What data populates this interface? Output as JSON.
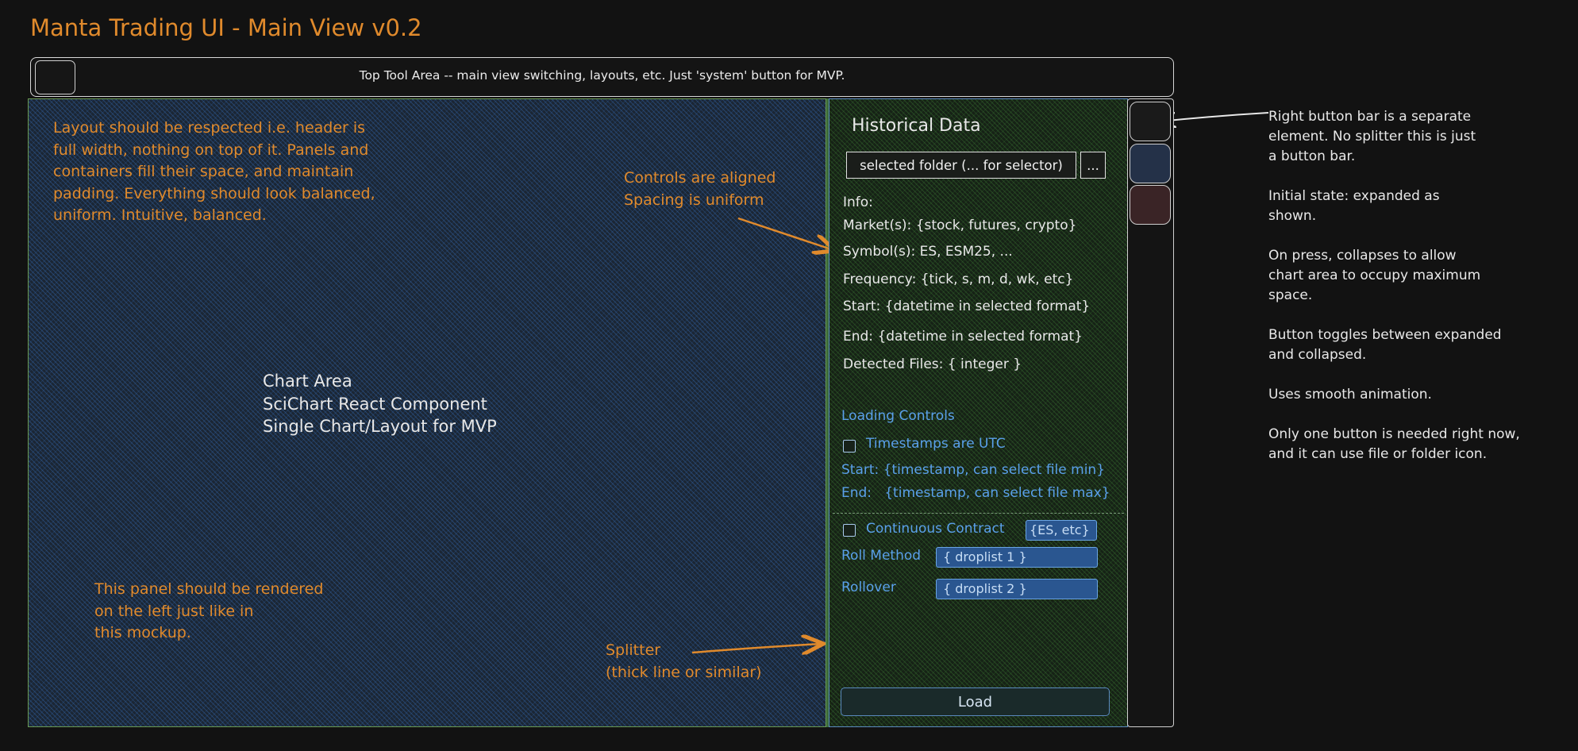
{
  "title": "Manta Trading UI - Main View v0.2",
  "top_bar": {
    "text": "Top Tool Area -- main view switching, layouts, etc.  Just 'system' button for MVP."
  },
  "chart_area": {
    "label_lines": [
      "Chart Area",
      "SciChart React Component",
      "Single Chart/Layout for MVP"
    ],
    "note_layout": "Layout should be respected i.e. header is\nfull width, nothing on top of it.  Panels and\ncontainers fill their space, and maintain\npadding.  Everything should look balanced,\nuniform.  Intuitive, balanced.",
    "note_controls": "Controls are aligned\nSpacing is uniform",
    "note_left_panel": "This panel should be rendered\non the left just like in\nthis mockup.",
    "note_splitter": "Splitter\n(thick line or similar)"
  },
  "side_panel": {
    "heading": "Historical Data",
    "folder_field": "selected folder (... for selector)",
    "browse_button": "...",
    "info": {
      "label": "Info:",
      "markets": "Market(s):  {stock, futures, crypto}",
      "symbols": "Symbol(s):  ES, ESM25, ...",
      "frequency": "Frequency:  {tick, s, m, d, wk, etc}",
      "start": "Start:  {datetime in selected format}",
      "end": "End: {datetime in selected format}",
      "detected_files": "Detected Files: { integer }"
    },
    "loading": {
      "heading": "Loading Controls",
      "utc_label": "Timestamps are UTC",
      "utc_checked": false,
      "start": "Start: {timestamp, can select file min}",
      "end": "End:   {timestamp, can select file max}"
    },
    "contract": {
      "continuous_label": "Continuous Contract",
      "continuous_checked": false,
      "symbol_value": "{ES, etc}",
      "roll_method_label": "Roll Method",
      "roll_method_value": "{ droplist 1 }",
      "rollover_label": "Rollover",
      "rollover_value": "{ droplist 2 }"
    },
    "load_button": "Load"
  },
  "button_bar": {
    "buttons": [
      {
        "name": "folder-toggle-button",
        "color": "#1a1a1a"
      },
      {
        "name": "blue-button",
        "color": "#243148"
      },
      {
        "name": "red-button",
        "color": "#3a2426"
      }
    ]
  },
  "right_notes": "Right button bar is a separate\nelement.  No splitter this is just\na button bar.\n\nInitial state: expanded as\nshown.\n\nOn press, collapses to allow\nchart area to occupy maximum\nspace.\n\nButton toggles between expanded\nand collapsed.\n\nUses smooth animation.\n\nOnly one button is needed right now,\nand it can use file or folder icon.",
  "colors": {
    "accent_orange": "#e08a2c",
    "label_blue": "#5aa0ea",
    "chart_bg": "#1b2634",
    "side_bg": "#162216"
  }
}
